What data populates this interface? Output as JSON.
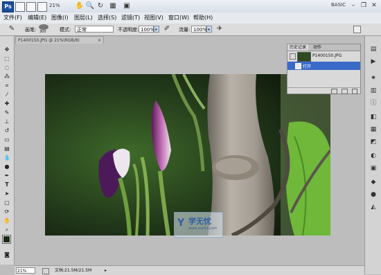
{
  "app": {
    "logo": "Ps",
    "zoom_combo": "21%",
    "workspace": "BASIC"
  },
  "menu": [
    {
      "label": "文件(F)"
    },
    {
      "label": "编辑(E)"
    },
    {
      "label": "图像(I)"
    },
    {
      "label": "图层(L)"
    },
    {
      "label": "选择(S)"
    },
    {
      "label": "滤镜(T)"
    },
    {
      "label": "视图(V)"
    },
    {
      "label": "窗口(W)"
    },
    {
      "label": "帮助(H)"
    }
  ],
  "options": {
    "brush_label": "画笔:",
    "brush_size": "300",
    "mode_label": "模式:",
    "mode_value": "正常",
    "opacity_label": "不透明度:",
    "opacity_value": "100%",
    "flow_label": "流量:",
    "flow_value": "100%"
  },
  "document": {
    "tab_title": "P1400150.JPG @ 21%(RGB/8)",
    "close": "×"
  },
  "history": {
    "tab_history": "历史记录",
    "tab_actions": "动作",
    "snapshot_name": "P1400150.JPG",
    "step_name": "打开"
  },
  "status": {
    "zoom": "21%",
    "doc_info": "文档:21.5M/21.5M"
  },
  "watermark": {
    "text": "学无忧",
    "url": "www.xue51.com"
  },
  "colors": {
    "selection": "#3a6ac8",
    "accent": "#1a4d9c"
  }
}
